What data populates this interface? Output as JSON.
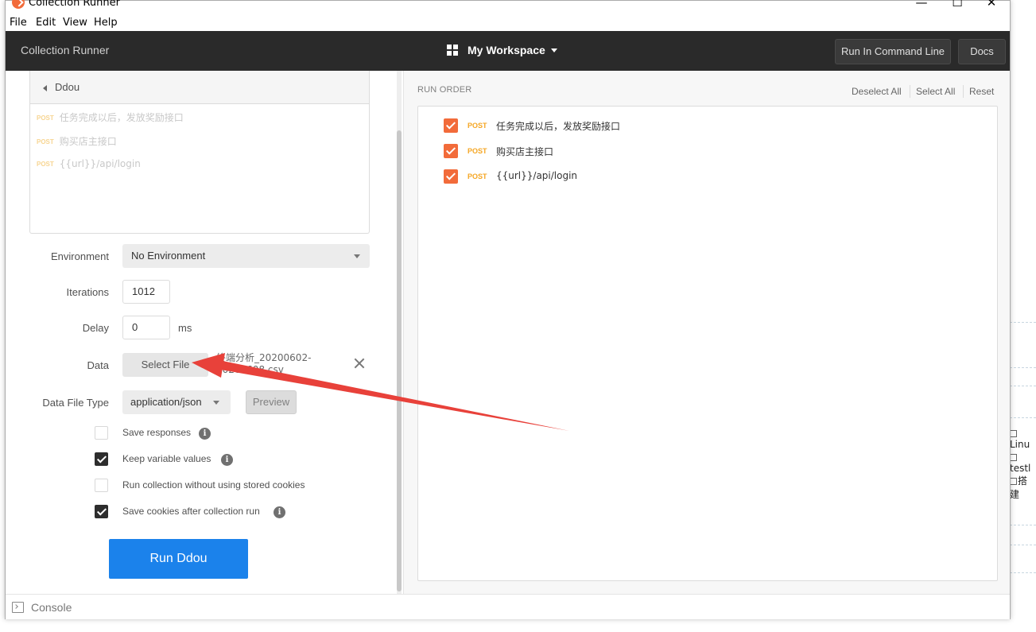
{
  "window": {
    "title": "Collection Runner",
    "controls": {
      "minimize": "—",
      "maximize": "☐",
      "close": "✕"
    }
  },
  "menu": [
    "File",
    "Edit",
    "View",
    "Help"
  ],
  "header": {
    "title": "Collection Runner",
    "workspace": "My Workspace",
    "run_cli_label": "Run In Command Line",
    "docs_label": "Docs"
  },
  "collection": {
    "name": "Ddou",
    "requests": [
      {
        "method": "POST",
        "name": "任务完成以后，发放奖励接口"
      },
      {
        "method": "POST",
        "name": "购买店主接口"
      },
      {
        "method": "POST",
        "name": "{{url}}/api/login"
      }
    ]
  },
  "form": {
    "environment_label": "Environment",
    "environment_value": "No Environment",
    "iterations_label": "Iterations",
    "iterations_value": "1012",
    "delay_label": "Delay",
    "delay_value": "0",
    "delay_unit": "ms",
    "data_label": "Data",
    "select_file_label": "Select File",
    "data_file_name": "终端分析_20200602-20200608.csv",
    "data_file_type_label": "Data File Type",
    "data_file_type_value": "application/json",
    "preview_label": "Preview"
  },
  "options": [
    {
      "label": "Save responses",
      "checked": false,
      "info": true
    },
    {
      "label": "Keep variable values",
      "checked": true,
      "info": true
    },
    {
      "label": "Run collection without using stored cookies",
      "checked": false,
      "info": false
    },
    {
      "label": "Save cookies after collection run",
      "checked": true,
      "info": true
    }
  ],
  "run_button_label": "Run Ddou",
  "run_order": {
    "title": "RUN ORDER",
    "deselect_all": "Deselect All",
    "select_all": "Select All",
    "reset": "Reset",
    "items": [
      {
        "method": "POST",
        "name": "任务完成以后，发放奖励接口",
        "checked": true
      },
      {
        "method": "POST",
        "name": "购买店主接口",
        "checked": true
      },
      {
        "method": "POST",
        "name": "{{url}}/api/login",
        "checked": true
      }
    ]
  },
  "footer": {
    "console_label": "Console"
  },
  "background_window": {
    "right_items": [
      "Linu",
      "testl",
      "搭建"
    ]
  },
  "colors": {
    "header_bg": "#2a2a2a",
    "accent_orange": "#f26b3a",
    "post_method": "#f5a623",
    "run_button": "#1b82eb",
    "annotation_arrow": "#e8413a"
  }
}
